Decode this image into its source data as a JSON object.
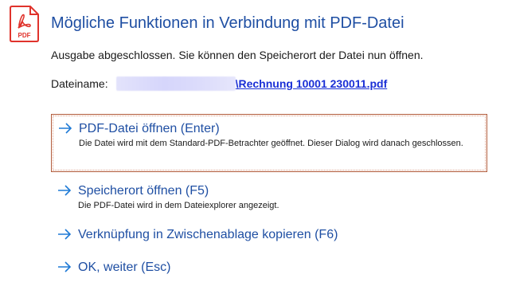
{
  "dialog": {
    "title": "Mögliche Funktionen in Verbindung mit PDF-Datei",
    "status": "Ausgabe abgeschlossen. Sie können den Speicherort der Datei nun öffnen.",
    "icon": "pdf-file-icon",
    "icon_label": "PDF",
    "accent_color": "#e0332c"
  },
  "file": {
    "label": "Dateiname:",
    "link_text": "\\Rechnung 10001 230011.pdf"
  },
  "options": [
    {
      "title": "PDF-Datei öffnen (Enter)",
      "description": "Die Datei wird mit dem Standard-PDF-Betrachter geöffnet. Dieser Dialog wird danach geschlossen."
    },
    {
      "title": "Speicherort öffnen (F5)",
      "description": "Die PDF-Datei wird in dem Dateiexplorer angezeigt."
    },
    {
      "title": "Verknüpfung in Zwischenablage kopieren (F6)"
    },
    {
      "title": "OK, weiter (Esc)"
    }
  ]
}
